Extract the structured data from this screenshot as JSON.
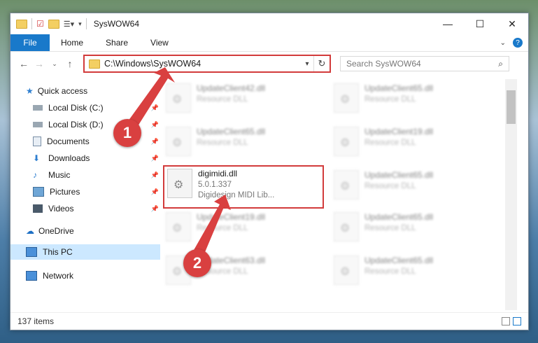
{
  "window": {
    "title": "SysWOW64"
  },
  "ribbon": {
    "file": "File",
    "tabs": [
      "Home",
      "Share",
      "View"
    ],
    "help": "?"
  },
  "address": {
    "path": "C:\\Windows\\SysWOW64"
  },
  "search": {
    "placeholder": "Search SysWOW64"
  },
  "sidebar": {
    "items": [
      {
        "label": "Quick access"
      },
      {
        "label": "Local Disk (C:)"
      },
      {
        "label": "Local Disk (D:)"
      },
      {
        "label": "Documents"
      },
      {
        "label": "Downloads"
      },
      {
        "label": "Music"
      },
      {
        "label": "Pictures"
      },
      {
        "label": "Videos"
      },
      {
        "label": "OneDrive"
      },
      {
        "label": "This PC"
      },
      {
        "label": "Network"
      }
    ]
  },
  "files": [
    {
      "name": "UpdateClient42.dll",
      "type": "Resource DLL"
    },
    {
      "name": "UpdateClient65.dll",
      "type": "Resource DLL"
    },
    {
      "name": "UpdateClient65.dll",
      "type": "Resource DLL"
    },
    {
      "name": "UpdateClient19.dll",
      "type": "Resource DLL"
    },
    {
      "name": "digimidi.dll",
      "version": "5.0.1.337",
      "description": "Digidesign MIDI Lib..."
    },
    {
      "name": "UpdateClient65.dll",
      "type": "Resource DLL"
    },
    {
      "name": "UpdateClient19.dll",
      "type": "Resource DLL"
    },
    {
      "name": "UpdateClient65.dll",
      "type": "Resource DLL"
    },
    {
      "name": "UpdateClient63.dll",
      "type": "Resource DLL"
    },
    {
      "name": "UpdateClient65.dll",
      "type": "Resource DLL"
    }
  ],
  "status": {
    "count": "137 items"
  },
  "callouts": [
    "1",
    "2"
  ],
  "colors": {
    "accent": "#1979ca",
    "highlight": "#d23b3b",
    "selected": "#cce8ff"
  }
}
